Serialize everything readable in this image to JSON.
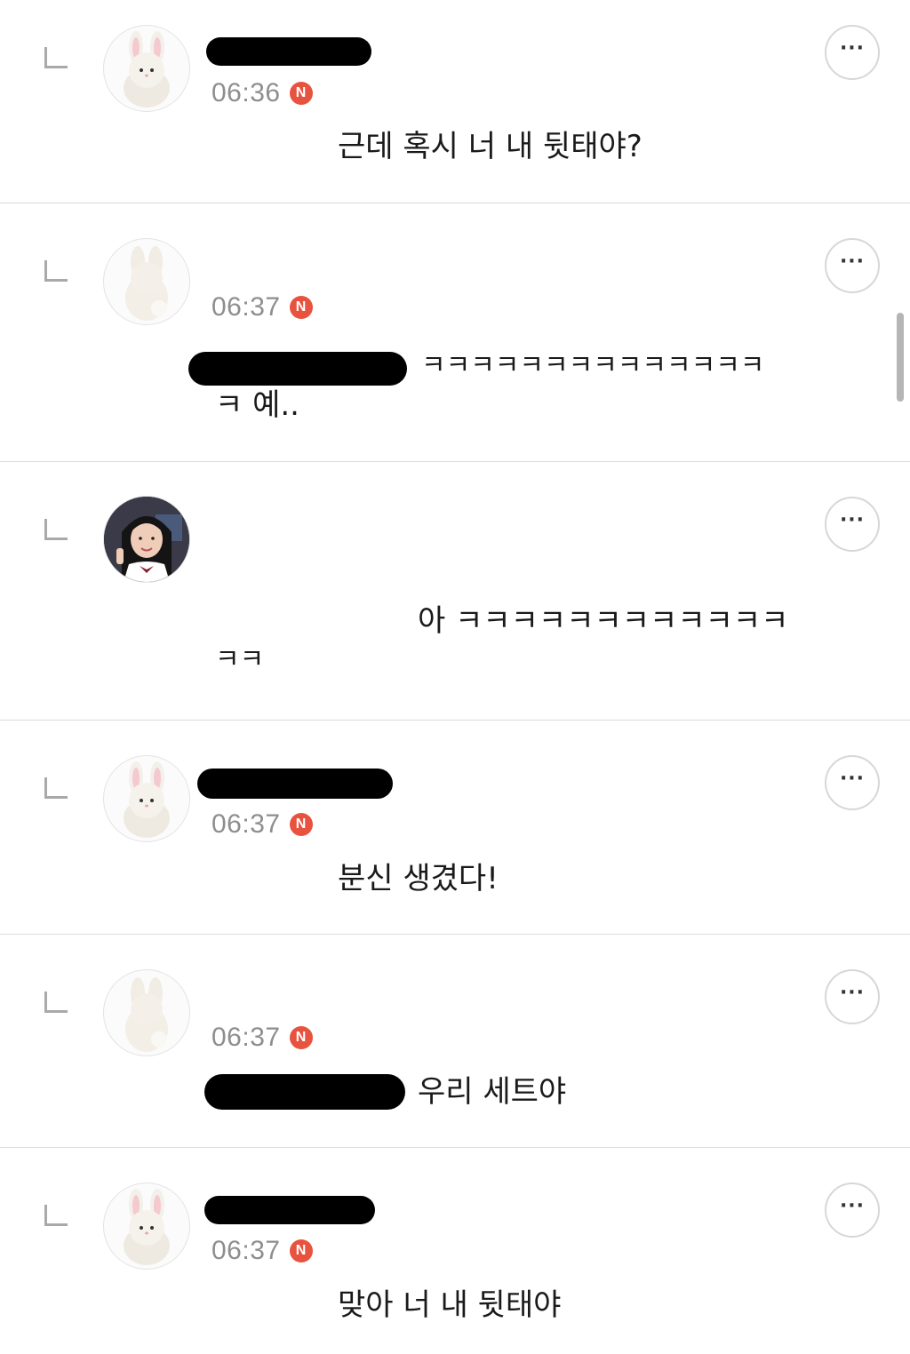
{
  "comments": [
    {
      "time": "06:36",
      "new_badge": "N",
      "more_label": "···",
      "text": "근데 혹시 너 내 뒷태야?"
    },
    {
      "time": "06:37",
      "new_badge": "N",
      "more_label": "···",
      "text_line1": "ㅋㅋㅋㅋㅋㅋㅋㅋㅋㅋㅋㅋㅋㅋ",
      "text_line2": "ㅋ 예.."
    },
    {
      "more_label": "···",
      "text_line1": "아 ㅋㅋㅋㅋㅋㅋㅋㅋㅋㅋㅋㅋ",
      "text_line2": "ㅋㅋ"
    },
    {
      "time": "06:37",
      "new_badge": "N",
      "more_label": "···",
      "text": "분신 생겼다!"
    },
    {
      "time": "06:37",
      "new_badge": "N",
      "more_label": "···",
      "text": "우리 세트야"
    },
    {
      "time": "06:37",
      "new_badge": "N",
      "more_label": "···",
      "text": "맞아 너 내 뒷태야"
    }
  ],
  "colors": {
    "new_badge": "#e8533f",
    "time_text": "#8e8e8e",
    "divider": "#dcdcdc",
    "redaction": "#000000"
  },
  "icons": {
    "reply_arrow": "reply-arrow-icon",
    "more": "more-dots-icon",
    "avatar_bunny_front": "bunny-plush-avatar",
    "avatar_bunny_back": "bunny-plush-back-avatar",
    "avatar_photo": "user-photo-avatar"
  }
}
